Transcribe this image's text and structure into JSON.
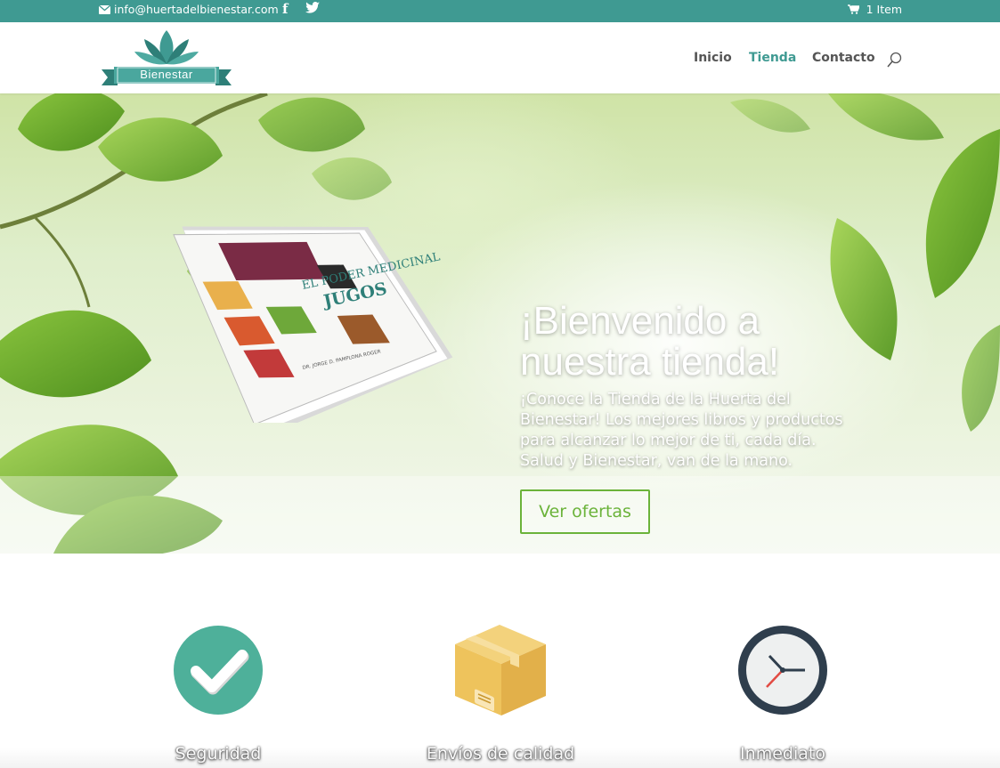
{
  "topbar": {
    "email": "info@huertadelbienestar.com",
    "social": [
      "facebook-icon",
      "twitter-icon"
    ],
    "cart_label": "1 Item"
  },
  "header": {
    "logo_text": "Bienestar",
    "nav": [
      "Inicio",
      "Tienda",
      "Contacto"
    ],
    "active_nav": "Tienda"
  },
  "hero": {
    "title": "¡Bienvenido a nuestra tienda!",
    "text": "¡Conoce la Tienda de la Huerta del Bienestar! Los mejores libros y productos para alcanzar lo mejor de ti, cada día. Salud y Bienestar, van de la mano.",
    "button": "Ver ofertas",
    "book": {
      "title_line1": "EL PODER MEDICINAL",
      "title_line2": "JUGOS",
      "author": "DR. JORGE D. PAMPLONA ROGER"
    }
  },
  "features": [
    {
      "icon": "check-circle-icon",
      "label": "Seguridad"
    },
    {
      "icon": "package-box-icon",
      "label": "Envíos de calidad"
    },
    {
      "icon": "clock-icon",
      "label": "Inmediato"
    }
  ],
  "colors": {
    "brand_teal": "#3f9a92",
    "button_green": "#6bb33a",
    "box_yellow": "#eec35c",
    "clock_dark": "#2f3e4d"
  }
}
